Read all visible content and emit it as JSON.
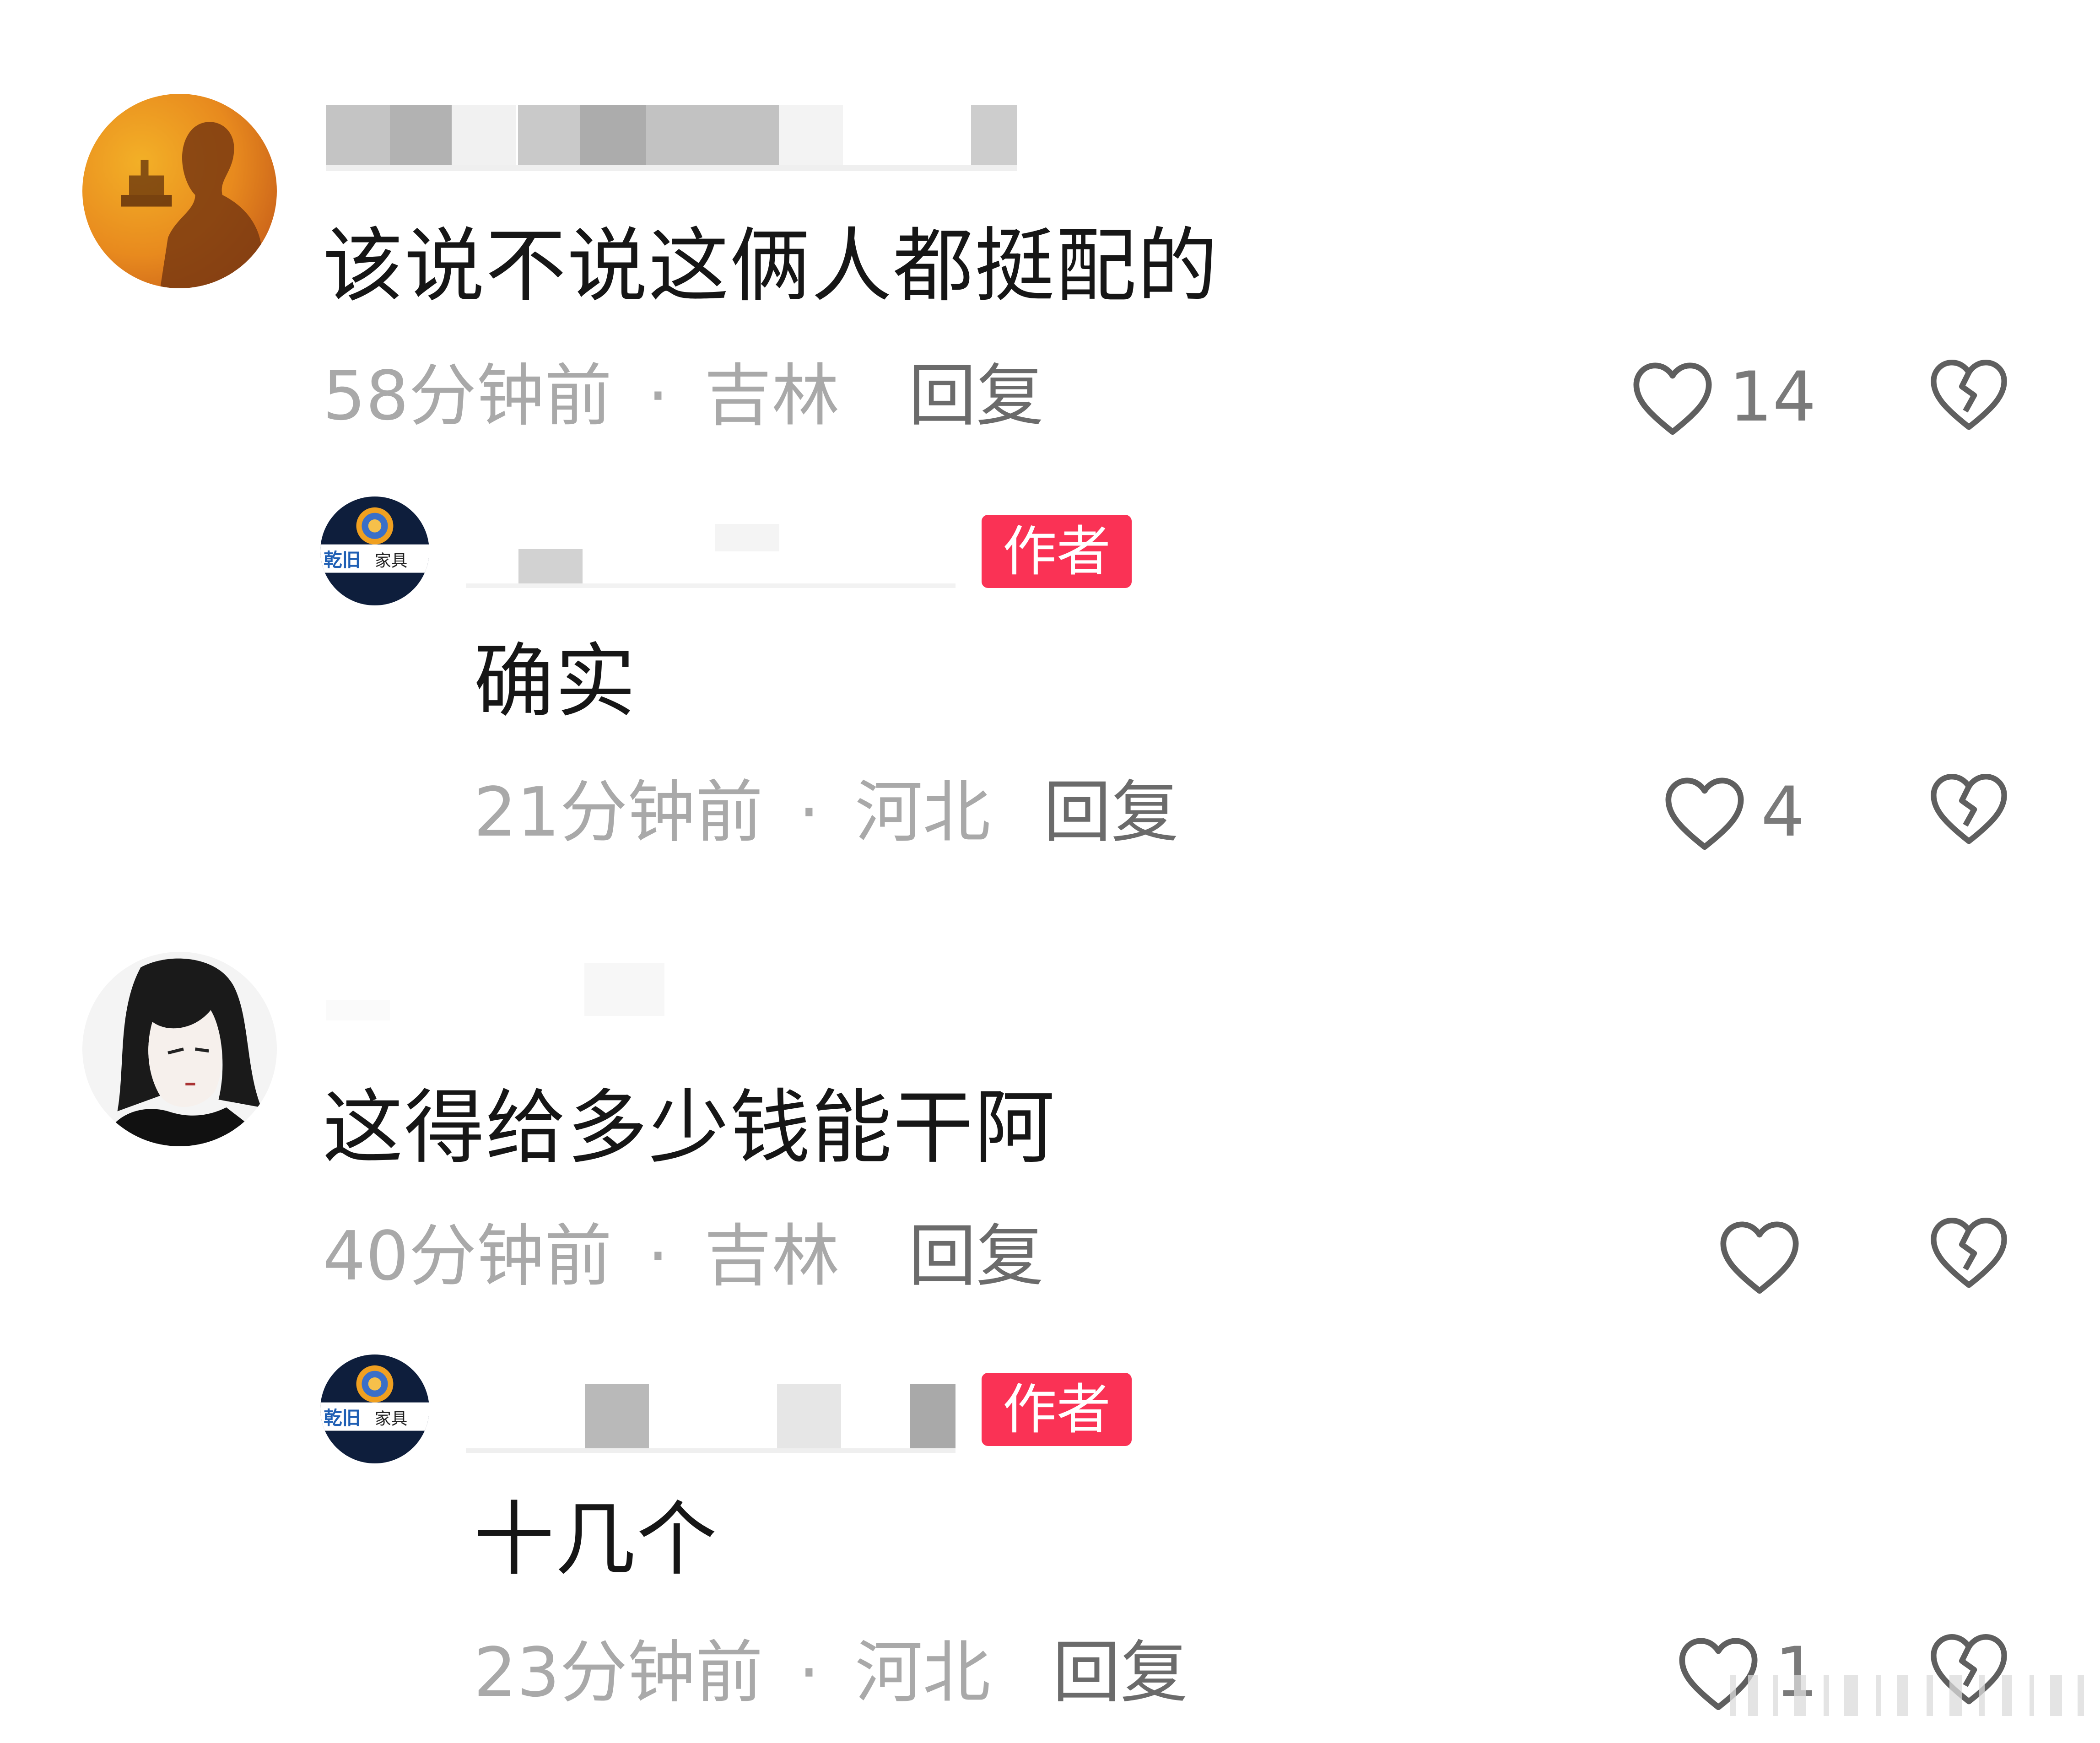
{
  "comments": [
    {
      "text": "该说不说这俩人都挺配的",
      "time": "58分钟前",
      "location": "吉林",
      "reply_label": "回复",
      "likes": "14",
      "avatar": "silhouette-avatar",
      "replies": [
        {
          "author_badge": "作者",
          "text": "确实",
          "time": "21分钟前",
          "location": "河北",
          "reply_label": "回复",
          "likes": "4",
          "avatar": "furniture-logo-avatar"
        }
      ]
    },
    {
      "text": "这得给多少钱能干阿",
      "time": "40分钟前",
      "location": "吉林",
      "reply_label": "回复",
      "likes": "",
      "avatar": "anime-portrait-avatar",
      "replies": [
        {
          "author_badge": "作者",
          "text": "十几个",
          "time": "23分钟前",
          "location": "河北",
          "reply_label": "回复",
          "likes": "1",
          "avatar": "furniture-logo-avatar"
        }
      ]
    }
  ],
  "logo_avatar_text": "乾旧家具",
  "separator": "·",
  "icons": {
    "like": "heart-outline-icon",
    "dislike": "broken-heart-icon"
  },
  "colors": {
    "author_badge": "#fa3255",
    "meta_text": "#a9a9a9",
    "reply_text": "#6b6b6b",
    "icon_stroke": "#5f5f5f"
  }
}
